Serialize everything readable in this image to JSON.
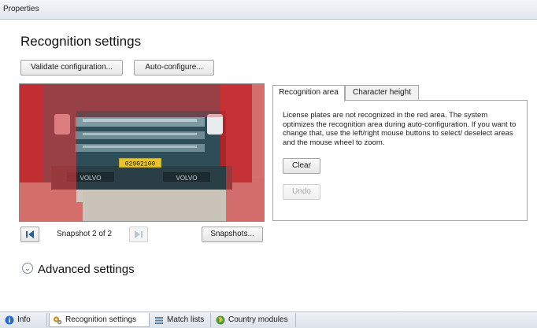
{
  "window": {
    "title": "Properties"
  },
  "heading": "Recognition settings",
  "toolbar": {
    "validate_label": "Validate configuration...",
    "autoconfig_label": "Auto-configure..."
  },
  "snapshot": {
    "plate_text": "02902100",
    "badge_left": "VOLVO",
    "badge_right": "VOLVO",
    "label": "Snapshot 2 of 2",
    "snapshots_button": "Snapshots..."
  },
  "tabs": [
    {
      "label": "Recognition area",
      "active": true
    },
    {
      "label": "Character height",
      "active": false
    }
  ],
  "recognition_area": {
    "description": "License plates are not recognized in the red area. The system optimizes the recognition area during auto-configuration. If you want to change that, use the left/right mouse buttons to select/ deselect areas and the mouse wheel to zoom.",
    "clear_label": "Clear",
    "undo_label": "Undo"
  },
  "advanced": {
    "label": "Advanced settings"
  },
  "bottom_tabs": [
    {
      "label": "Info",
      "icon": "info-icon"
    },
    {
      "label": "Recognition settings",
      "icon": "gears-icon",
      "active": true
    },
    {
      "label": "Match lists",
      "icon": "list-icon"
    },
    {
      "label": "Country modules",
      "icon": "globe-icon"
    }
  ],
  "colors": {
    "overlay_red": "#d8383a",
    "truck_teal": "#2e5560",
    "plate_yellow": "#e7c42a"
  }
}
